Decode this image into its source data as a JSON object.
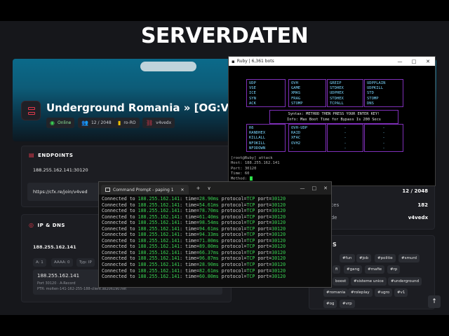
{
  "site": {
    "title": "SERVERDATEN",
    "server_name": "Underground Romania » [OG:V1]",
    "chips": {
      "status": "Online",
      "players": "12 / 2048",
      "locale": "ro-RO",
      "code": "v4vedx"
    },
    "endpoints": {
      "heading": "ENDPOINTS",
      "ip": "188.255.162.141:30120",
      "url": "https://cfx.re/join/v4ved"
    },
    "ipdns": {
      "heading": "IP & DNS",
      "ip": "188.255.162.141",
      "filters": [
        "A: 1",
        "AAAA: 0",
        "Typ: IP"
      ],
      "record_ip": "188.255.162.141",
      "record_meta": "Port 30120 · A-Record",
      "ptr": "PTR: molten-141-162-255-188-client.as206190.net"
    },
    "stats": [
      {
        "label": "ers",
        "value": "12 / 2048"
      },
      {
        "label": "ources",
        "value": "182"
      },
      {
        "label": "-Code",
        "value": "v4vedx"
      }
    ],
    "tags_heading": "S",
    "tags": [
      "#fun",
      "#job",
      "#politie",
      "#smurd",
      "fi",
      "#gang",
      "#mafie",
      "#rp",
      "boost",
      "#sisteme unice",
      "#underground",
      "#romania",
      "#roleplay",
      "#ugro",
      "#v1",
      "#og",
      "#vrp"
    ]
  },
  "ruby": {
    "title": "Ruby | 6,361 bots",
    "col1": [
      "UDP",
      "VSE",
      "ICE",
      "SYN",
      "ACK"
    ],
    "col2": [
      "OVH",
      "GAME",
      "XMAS",
      "FRAG",
      "STOMP"
    ],
    "col3": [
      "GREIP",
      "STDHEX",
      "UDPHEX",
      "STDHEX",
      "TCPALL"
    ],
    "col4": [
      "UDPPLAIN",
      "UDPKILL",
      "STD",
      "STOMP",
      "DNS"
    ],
    "syntax_line1": "Syntax: METHOD THEN PRESS YOUR ENTER KEY!",
    "syntax_line2": "Info: Max Boot Time for Bypass Is 200 Secs",
    "col5": [
      "R6",
      "RANDHEX",
      "KILLALL",
      "NFOKILL",
      "NFODOWN"
    ],
    "col6": [
      "OVH-UDP",
      "RAID",
      "XFAC",
      "OVH2",
      "-"
    ],
    "col7": [
      "-",
      "-",
      "-",
      "-",
      "-"
    ],
    "col8": [
      "-",
      "-",
      "-",
      "-",
      "-"
    ],
    "prompt": "[root@Ruby] attack",
    "host": "Host: 188.255.162.141",
    "port": "Port: 30120",
    "time": "Time: 60",
    "method": "Method: "
  },
  "cmd": {
    "tab_title": "Command Prompt - paping 1",
    "new_tab": "+",
    "dropdown": "∨",
    "host": "188.255.162.141",
    "times": [
      "28.90ms",
      "54.61ms",
      "78.70ms",
      "61.40ms",
      "98.54ms",
      "94.61ms",
      "94.33ms",
      "71.80ms",
      "89.80ms",
      "66.37ms",
      "96.87ms",
      "28.90ms",
      "82.61ms",
      "60.80ms"
    ],
    "protocol": "TCP",
    "port": "30120",
    "prefix": "Connected to ",
    "time_label": " time=",
    "protocol_label": " protocol=",
    "port_label": " port="
  }
}
